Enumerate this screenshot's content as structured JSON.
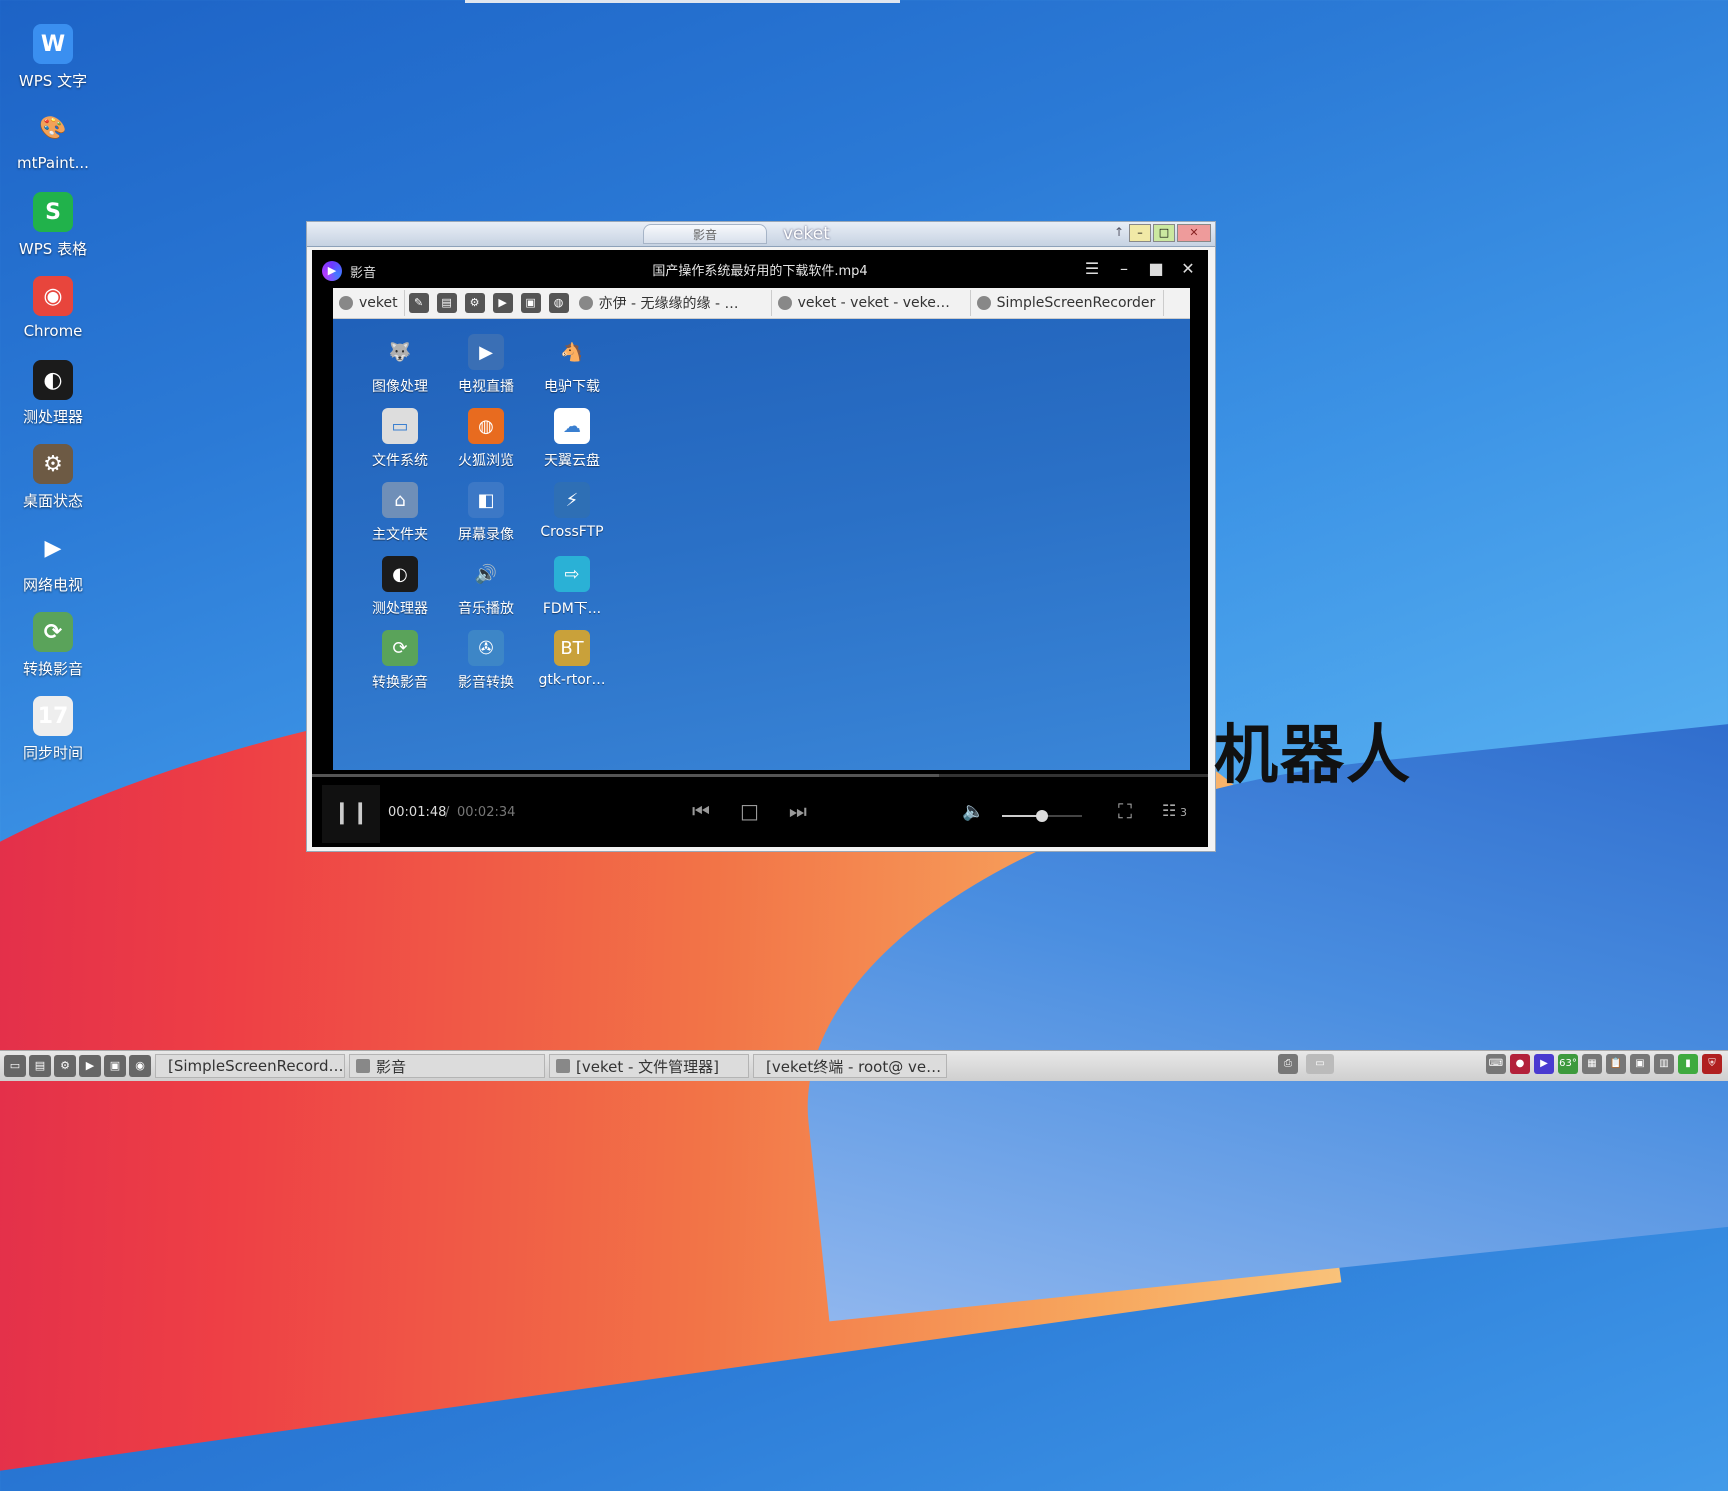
{
  "desktop": {
    "icons": [
      {
        "label": "WPS 文字",
        "glyph": "W",
        "color": "#3a8ff0",
        "icon": "wps-writer-icon"
      },
      {
        "label": "mtPaint...",
        "glyph": "🎨",
        "color": "transparent",
        "icon": "mtpaint-icon"
      },
      {
        "label": "WPS 表格",
        "glyph": "S",
        "color": "#21b24b",
        "icon": "wps-sheet-icon"
      },
      {
        "label": "Chrome",
        "glyph": "◉",
        "color": "#e8453c",
        "icon": "chrome-icon"
      },
      {
        "label": "测处理器",
        "glyph": "◐",
        "color": "#1b1b1b",
        "icon": "cpu-tester-icon"
      },
      {
        "label": "桌面状态",
        "glyph": "⚙",
        "color": "#6d5a44",
        "icon": "desktop-status-icon"
      },
      {
        "label": "网络电视",
        "glyph": "▶",
        "color": "transparent",
        "icon": "network-tv-icon"
      },
      {
        "label": "转换影音",
        "glyph": "⟳",
        "color": "#5aa35a",
        "icon": "convert-media-icon"
      },
      {
        "label": "同步时间",
        "glyph": "17",
        "color": "#eeeeee",
        "icon": "calendar-icon"
      }
    ]
  },
  "outer_window": {
    "tab_label": "影音",
    "title": "veket",
    "btn_pin": "↑",
    "btn_min": "–",
    "btn_max": "□",
    "btn_close": "✕"
  },
  "player": {
    "app_name": "影音",
    "logo_glyph": "▶",
    "file_name": "国产操作系统最好用的下载软件.mp4",
    "menu_icon": "☰",
    "min_icon": "–",
    "max_icon": "■",
    "close_icon": "✕",
    "time_current": "00:01:48",
    "time_separator": "/",
    "time_total": "00:02:34",
    "progress": 0.7,
    "volume": 0.5,
    "pause_glyph": "❙❙",
    "prev_glyph": "⏮",
    "stop_glyph": "□",
    "next_glyph": "⏭",
    "volume_glyph": "🔈",
    "fullscreen_glyph": "⛶",
    "playlist_glyph": "☷",
    "playlist_count": "3"
  },
  "video_frame": {
    "taskbar": {
      "first": "veket",
      "tasks": [
        "亦伊 - 无缘缘的缘 - …",
        "veket - veket - veke…",
        "SimpleScreenRecorder"
      ]
    },
    "icons": [
      {
        "label": "图像处理",
        "glyph": "🐺",
        "color": "transparent"
      },
      {
        "label": "电视直播",
        "glyph": "▶",
        "color": "#3a6fb5"
      },
      {
        "label": "电驴下载",
        "glyph": "🐴",
        "color": "transparent"
      },
      {
        "label": "文件系统",
        "glyph": "▭",
        "color": "#dddddd"
      },
      {
        "label": "火狐浏览",
        "glyph": "◍",
        "color": "#e86b1f"
      },
      {
        "label": "天翼云盘",
        "glyph": "☁",
        "color": "#ffffff"
      },
      {
        "label": "主文件夹",
        "glyph": "⌂",
        "color": "#6f8fb8"
      },
      {
        "label": "屏幕录像",
        "glyph": "◧",
        "color": "#3c78c6"
      },
      {
        "label": "CrossFTP",
        "glyph": "⚡",
        "color": "#2e6fb5"
      },
      {
        "label": "测处理器",
        "glyph": "◐",
        "color": "#1b1b1b"
      },
      {
        "label": "音乐播放",
        "glyph": "🔊",
        "color": "transparent"
      },
      {
        "label": "FDM下...",
        "glyph": "⇨",
        "color": "#2ab1d6"
      },
      {
        "label": "转换影音",
        "glyph": "⟳",
        "color": "#5aa35a"
      },
      {
        "label": "影音转换",
        "glyph": "✇",
        "color": "#3d86c7"
      },
      {
        "label": "gtk-rtor…",
        "glyph": "BT",
        "color": "#c9a13a"
      }
    ]
  },
  "overlay_text": "机器人",
  "taskbar": {
    "tasks": [
      {
        "label": "[SimpleScreenRecord…",
        "icon": "screen-recorder-icon"
      },
      {
        "label": "影音",
        "icon": "media-player-icon"
      },
      {
        "label": "[veket - 文件管理器]",
        "icon": "file-manager-icon"
      },
      {
        "label": "[veket终端 - root@ ve…",
        "icon": "terminal-icon"
      }
    ],
    "tray_temp": "63°"
  }
}
